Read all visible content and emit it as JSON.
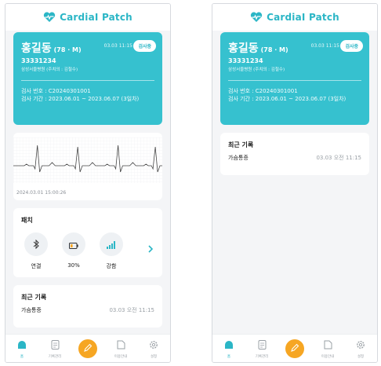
{
  "app": {
    "brand": "CardiaI Patch"
  },
  "patient": {
    "name": "홍길동",
    "meta": "(78 · M)",
    "time": "03.03 11:15",
    "status": "검사중",
    "id": "33331234",
    "hospital": "삼성서울병원 (주치의 : 김철수)",
    "exam_no": "검사 번호 : C20240301001",
    "exam_period": "검사 기간 : 2023.06.01 ~ 2023.06.07 (3일차)"
  },
  "ecg": {
    "timestamp": "2024.03.01 15:00:26"
  },
  "patch": {
    "title": "패치",
    "items": [
      {
        "icon": "bluetooth-icon",
        "label": "연결"
      },
      {
        "icon": "battery-icon",
        "label": "30%"
      },
      {
        "icon": "signal-icon",
        "label": "강함"
      }
    ]
  },
  "recent": {
    "title": "최근 기록",
    "items": [
      {
        "label": "가슴통증",
        "time": "03.03 오전 11:15"
      }
    ]
  },
  "nav": {
    "items": [
      {
        "icon": "home-icon",
        "label": "홈",
        "active": true
      },
      {
        "icon": "record-icon",
        "label": "기록관리"
      },
      {
        "icon": "pencil-icon",
        "label": ""
      },
      {
        "icon": "guide-icon",
        "label": "이용안내"
      },
      {
        "icon": "settings-icon",
        "label": "설정"
      }
    ]
  },
  "colors": {
    "accent": "#36c1cf",
    "fab": "#f6a623"
  }
}
